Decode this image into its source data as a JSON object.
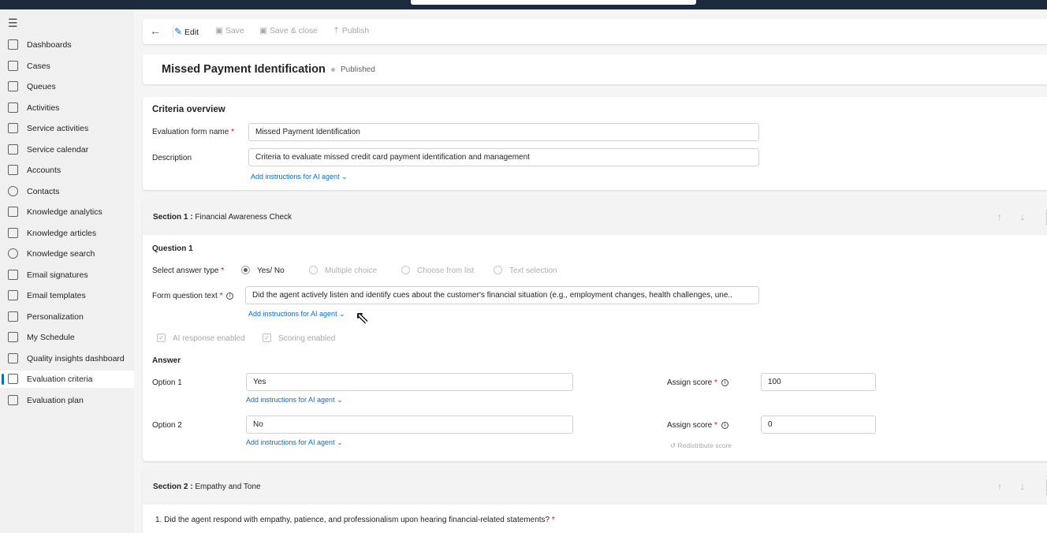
{
  "icons": {
    "menu": "hamburger-icon",
    "back": "arrow-left-icon",
    "edit": "pencil-icon",
    "save": "floppy-disk-icon",
    "save_close": "save-close-icon",
    "publish": "publish-icon",
    "info": "info-icon",
    "chevron": "chevron-down-icon",
    "up": "arrow-up-icon",
    "down": "arrow-down-icon",
    "cursor": "mouse-pointer-icon",
    "redistribute": "undo-icon"
  },
  "sidebar": {
    "items": [
      {
        "label": "Dashboards",
        "icon": "dashboard-icon"
      },
      {
        "label": "Cases",
        "icon": "wrench-icon"
      },
      {
        "label": "Queues",
        "icon": "queue-icon"
      },
      {
        "label": "Activities",
        "icon": "clipboard-icon"
      },
      {
        "label": "Service activities",
        "icon": "service-activity-icon"
      },
      {
        "label": "Service calendar",
        "icon": "calendar-icon"
      },
      {
        "label": "Accounts",
        "icon": "building-icon"
      },
      {
        "label": "Contacts",
        "icon": "person-icon"
      },
      {
        "label": "Knowledge analytics",
        "icon": "analytics-icon"
      },
      {
        "label": "Knowledge articles",
        "icon": "book-icon"
      },
      {
        "label": "Knowledge search",
        "icon": "search-icon"
      },
      {
        "label": "Email signatures",
        "icon": "signature-icon"
      },
      {
        "label": "Email templates",
        "icon": "document-icon"
      },
      {
        "label": "Personalization",
        "icon": "personalization-icon"
      },
      {
        "label": "My Schedule",
        "icon": "schedule-icon"
      },
      {
        "label": "Quality insights dashboard",
        "icon": "insights-icon"
      },
      {
        "label": "Evaluation criteria",
        "icon": "evaluation-criteria-icon"
      },
      {
        "label": "Evaluation plan",
        "icon": "evaluation-plan-icon"
      }
    ],
    "active_index": 16
  },
  "toolbar": {
    "edit": "Edit",
    "save": "Save",
    "save_close": "Save & close",
    "publish": "Publish"
  },
  "header": {
    "title": "Missed Payment Identification",
    "status": "Published"
  },
  "overview": {
    "title": "Criteria overview",
    "name_label": "Evaluation form name",
    "required_mark": "*",
    "name_value": "Missed Payment Identification",
    "description_label": "Description",
    "description_value": "Criteria to evaluate missed credit card payment identification and management",
    "ai_link": "Add instructions for AI agent"
  },
  "section1": {
    "number": "Section 1 :",
    "title": "Financial Awareness Check",
    "question_title": "Question 1",
    "answer_type_label": "Select answer type",
    "answer_types": [
      "Yes/ No",
      "Multiple choice",
      "Choose from list",
      "Text selection"
    ],
    "selected_type": "Yes/ No",
    "question_text_label": "Form question text",
    "question_text": "Did the agent actively listen and identify cues about the customer's financial situation (e.g., employment changes, health challenges, une..",
    "ai_link": "Add instructions for AI agent",
    "ai_response_label": "AI response enabled",
    "scoring_label": "Scoring enabled",
    "answer_title": "Answer",
    "assign_score_label": "Assign score",
    "options": [
      {
        "label": "Option 1",
        "value": "Yes",
        "score": "100",
        "ai_link": "Add instructions for AI agent"
      },
      {
        "label": "Option 2",
        "value": "No",
        "score": "0",
        "ai_link": "Add instructions for AI agent"
      }
    ],
    "redistribute": "Redistribute score"
  },
  "section2": {
    "number": "Section 2 :",
    "title": "Empathy and Tone",
    "question": "1. Did the agent respond with empathy, patience, and professionalism upon hearing financial-related statements?"
  }
}
